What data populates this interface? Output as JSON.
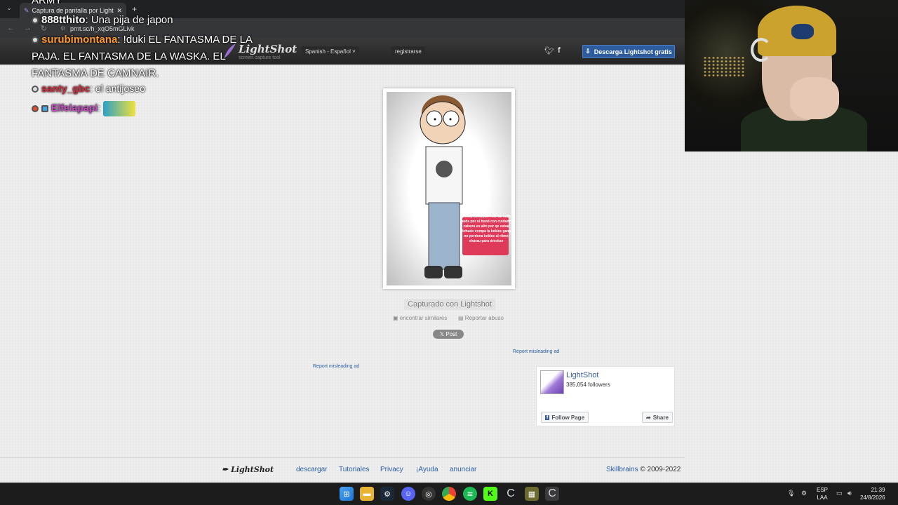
{
  "browser": {
    "tab_title": "Captura de pantalla por Lightsh",
    "url": "prnt.sc/h_xqO5mGLivk",
    "close_glyph": "✕",
    "new_tab_glyph": "+"
  },
  "header": {
    "logo_name": "LightShot",
    "logo_tagline": "screen capture tool",
    "language": "Spanish - Español",
    "register": "registrarse",
    "download_button": "Descarga Lightshot gratis"
  },
  "chat": {
    "partial_top": "ARMY",
    "messages": [
      {
        "user": "888tthito",
        "text": ": Una pija de japon",
        "color": "#ffffff"
      },
      {
        "user": "surubimontana",
        "text": ": !duki EL FANTASMA DE LA PAJA. EL FANTASMA DE LA WASKA. EL FANTASMA DE CAMNAIR.",
        "color": "#ff9a2e"
      },
      {
        "user": "santy_gbc",
        "text": ": el antijoseo",
        "color": "#d62f3d"
      },
      {
        "user": "Elfelapapi",
        "text": ":",
        "color": "#c84cc8"
      }
    ]
  },
  "screenshot": {
    "sticker_text": "moneynumdpain mierda kaila anda por el hood con cuidado cabeza en alto por qe estas fichado compa la keklee gang no perdona keklee al ritmo sharau para drecksə"
  },
  "actions": {
    "caption": "Capturado con Lightshot",
    "find_similar": "encontrar similares",
    "report_abuse": "Reportar abuso",
    "post_button": "Post"
  },
  "ads": {
    "report_1": "Report misleading ad",
    "report_2": "Report misleading ad"
  },
  "facebook_widget": {
    "page_name": "LightShot",
    "followers": "385,054 followers",
    "follow_button": "Follow Page",
    "share_button": "Share"
  },
  "footer": {
    "logo": "LightShot",
    "links": [
      "descargar",
      "Tutoriales",
      "Privacy",
      "¡Ayuda",
      "anunciar"
    ],
    "company": "Skillbrains",
    "copyright": "© 2009-2022"
  },
  "taskbar": {
    "lang_top": "ESP",
    "lang_bottom": "LAA",
    "time": "21:39",
    "date": "24/8/2026"
  },
  "colors": {
    "accent_blue": "#2a5ea5",
    "header_dark": "#2a2a2a",
    "download_button": "#2c5b9e"
  }
}
